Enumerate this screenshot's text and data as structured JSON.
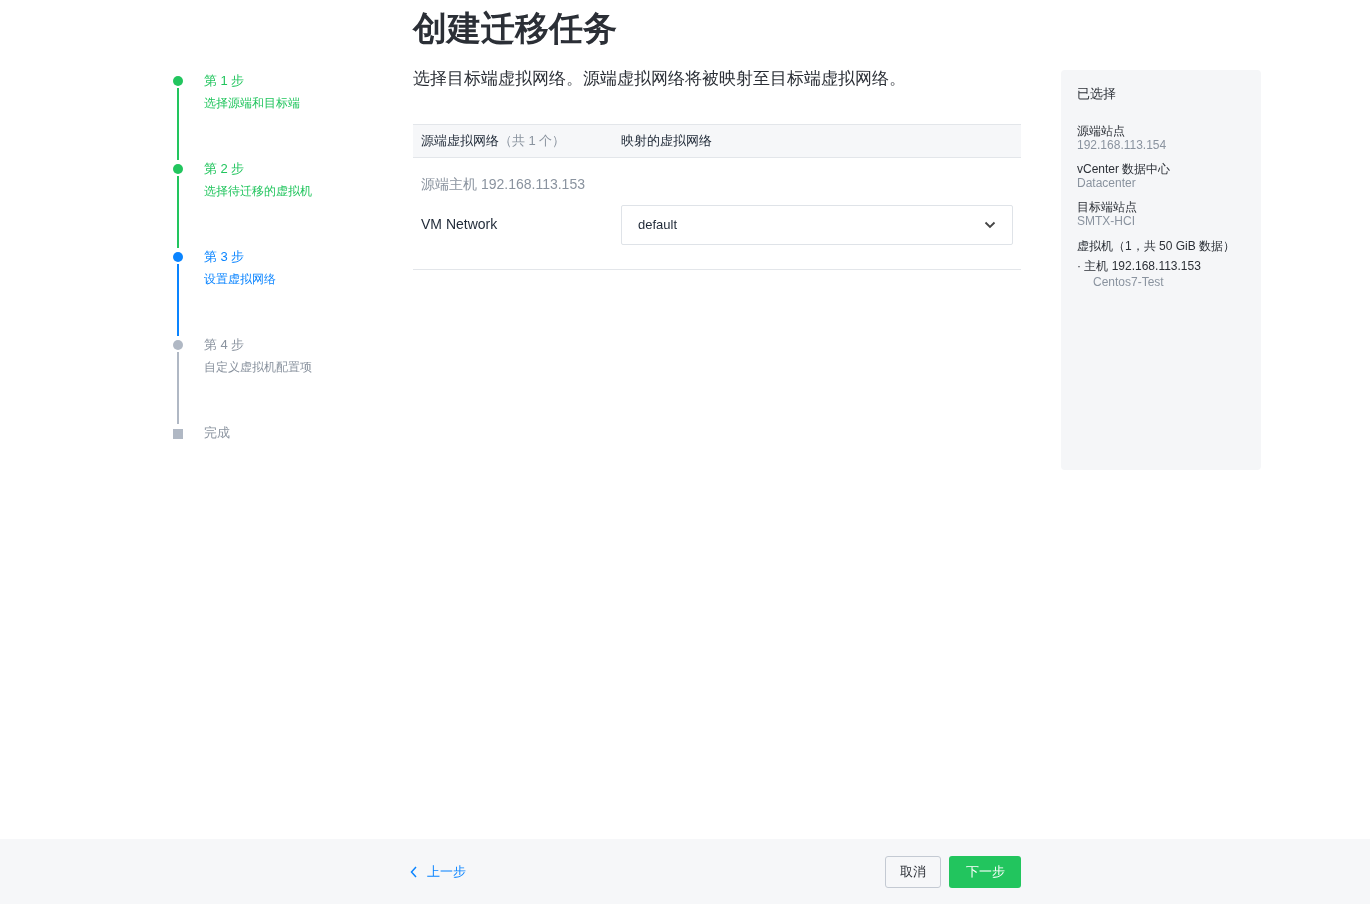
{
  "title": "创建迁移任务",
  "steps": [
    {
      "label": "第 1 步",
      "description": "选择源端和目标端",
      "kind": "done"
    },
    {
      "label": "第 2 步",
      "description": "选择待迁移的虚拟机",
      "kind": "done"
    },
    {
      "label": "第 3 步",
      "description": "设置虚拟网络",
      "kind": "current"
    },
    {
      "label": "第 4 步",
      "description": "自定义虚拟机配置项",
      "kind": "pending"
    },
    {
      "label": "完成",
      "kind": "final"
    }
  ],
  "instruction": "选择目标端虚拟网络。源端虚拟网络将被映射至目标端虚拟网络。",
  "table": {
    "columns": [
      {
        "label": "源端虚拟网络",
        "count": "（共 1 个）"
      },
      {
        "label": "映射的虚拟网络"
      }
    ],
    "groups": [
      {
        "title": "源端主机 192.168.113.153",
        "rows": [
          {
            "source": "VM Network",
            "target": "default"
          }
        ]
      }
    ]
  },
  "summary": {
    "title": "已选择",
    "items": [
      {
        "label": "源端站点",
        "value": "192.168.113.154"
      },
      {
        "label": "vCenter 数据中心",
        "value": "Datacenter"
      },
      {
        "label": "目标端站点",
        "value": "SMTX-HCI"
      }
    ],
    "vms": {
      "label": "虚拟机（1，共 50 GiB 数据）",
      "hosts": [
        {
          "name": "· 主机 192.168.113.153",
          "vms": [
            "Centos7-Test"
          ]
        }
      ]
    }
  },
  "footer": {
    "back": "上一步",
    "cancel": "取消",
    "next": "下一步"
  }
}
